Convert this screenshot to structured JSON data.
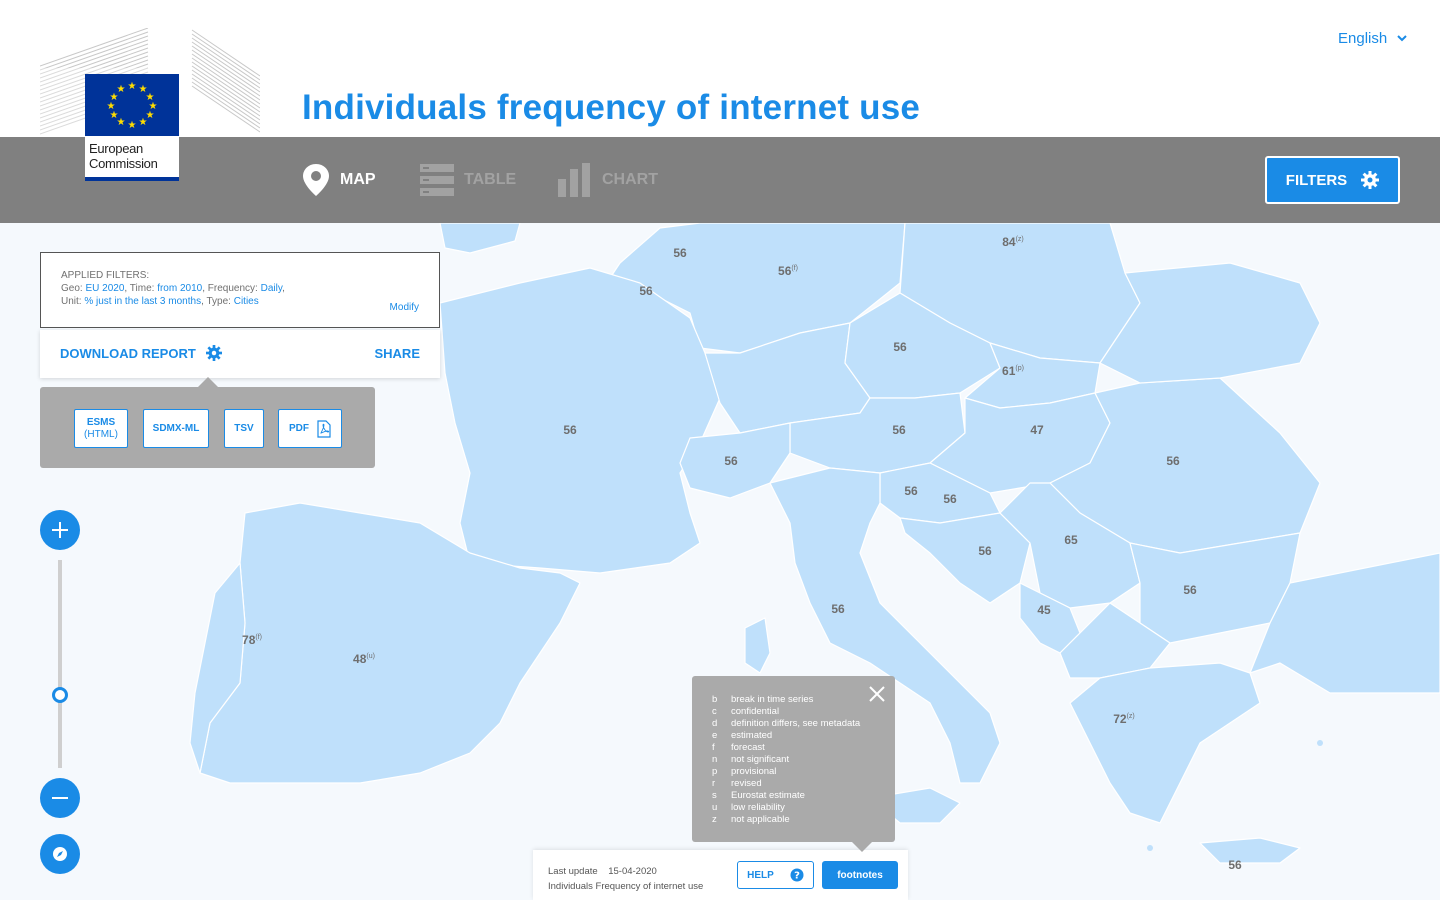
{
  "header": {
    "logo_text_line1": "European",
    "logo_text_line2": "Commission",
    "title": "Individuals frequency of internet use",
    "language": "English"
  },
  "toolbar": {
    "tabs": [
      {
        "label": "MAP",
        "icon": "map-pin-icon",
        "active": true
      },
      {
        "label": "TABLE",
        "icon": "table-icon",
        "active": false
      },
      {
        "label": "CHART",
        "icon": "bar-chart-icon",
        "active": false
      }
    ],
    "filters_label": "FILTERS"
  },
  "applied_filters": {
    "heading": "APPLIED FILTERS:",
    "geo_label": "Geo:",
    "geo_value": "EU 2020",
    "time_label": "Time:",
    "time_value": "from 2010",
    "frequency_label": "Frequency:",
    "frequency_value": "Daily",
    "unit_label": "Unit:",
    "unit_value": "% just in the last 3 months",
    "type_label": "Type:",
    "type_value": "Cities",
    "modify_label": "Modify"
  },
  "download": {
    "download_label": "DOWNLOAD REPORT",
    "share_label": "SHARE",
    "formats": [
      {
        "label": "ESMS",
        "sub": "(HTML)"
      },
      {
        "label": "SDMX-ML",
        "sub": ""
      },
      {
        "label": "TSV",
        "sub": ""
      },
      {
        "label": "PDF",
        "sub": ""
      }
    ]
  },
  "map_values": [
    {
      "country": "Benelux",
      "value": "56",
      "flag": ""
    },
    {
      "country": "Belgium",
      "value": "56",
      "flag": ""
    },
    {
      "country": "Germany",
      "value": "56",
      "flag": "(f)"
    },
    {
      "country": "Poland",
      "value": "84",
      "flag": "(z)"
    },
    {
      "country": "Czechia",
      "value": "56",
      "flag": ""
    },
    {
      "country": "Slovakia",
      "value": "61",
      "flag": "(p)"
    },
    {
      "country": "France",
      "value": "56",
      "flag": ""
    },
    {
      "country": "Austria",
      "value": "56",
      "flag": ""
    },
    {
      "country": "Hungary",
      "value": "47",
      "flag": ""
    },
    {
      "country": "Switzerland",
      "value": "56",
      "flag": ""
    },
    {
      "country": "Romania",
      "value": "56",
      "flag": ""
    },
    {
      "country": "Slovenia",
      "value": "56",
      "flag": ""
    },
    {
      "country": "Croatia",
      "value": "56",
      "flag": ""
    },
    {
      "country": "Serbia",
      "value": "65",
      "flag": ""
    },
    {
      "country": "Bosnia",
      "value": "56",
      "flag": ""
    },
    {
      "country": "Bulgaria",
      "value": "56",
      "flag": ""
    },
    {
      "country": "Italy",
      "value": "56",
      "flag": ""
    },
    {
      "country": "Montenegro",
      "value": "45",
      "flag": ""
    },
    {
      "country": "Portugal",
      "value": "78",
      "flag": "(f)"
    },
    {
      "country": "Spain",
      "value": "48",
      "flag": "(u)"
    },
    {
      "country": "Greece",
      "value": "72",
      "flag": "(z)"
    },
    {
      "country": "Crete",
      "value": "56",
      "flag": ""
    }
  ],
  "footnotes": [
    {
      "code": "b",
      "text": "break in time series"
    },
    {
      "code": "c",
      "text": "confidential"
    },
    {
      "code": "d",
      "text": "definition differs, see metadata"
    },
    {
      "code": "e",
      "text": "estimated"
    },
    {
      "code": "f",
      "text": "forecast"
    },
    {
      "code": "n",
      "text": "not significant"
    },
    {
      "code": "p",
      "text": "provisional"
    },
    {
      "code": "r",
      "text": "revised"
    },
    {
      "code": "s",
      "text": "Eurostat estimate"
    },
    {
      "code": "u",
      "text": "low reliability"
    },
    {
      "code": "z",
      "text": "not applicable"
    }
  ],
  "bottom_bar": {
    "last_update_label": "Last update",
    "last_update_value": "15-04-2020",
    "dataset_name": "Individuals Frequency of internet use",
    "help_label": "HELP",
    "footnotes_label": "footnotes"
  },
  "colors": {
    "accent": "#1a8be6",
    "toolbar": "#808080",
    "land": "#bfe0fb",
    "sea": "#f5f9fd"
  }
}
